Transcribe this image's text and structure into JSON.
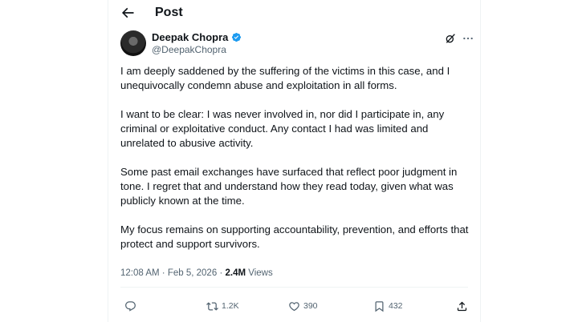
{
  "header": {
    "title": "Post"
  },
  "author": {
    "name": "Deepak Chopra",
    "handle": "@DeepakChopra"
  },
  "post": {
    "paragraphs": [
      "I am deeply saddened by the suffering of the victims in this case, and I unequivocally condemn abuse and exploitation in all forms.",
      "I want to be clear: I was never involved in, nor did I participate in, any criminal or exploitative conduct. Any contact I had was limited and unrelated to abusive activity.",
      "Some past email exchanges have surfaced that reflect poor judgment in tone. I regret that and understand how they read today, given what was publicly known at the time.",
      "My focus remains on supporting accountability, prevention, and efforts that protect and support survivors."
    ],
    "time": "12:08 AM",
    "dot": "·",
    "date": "Feb 5, 2026",
    "views_count": "2.4M",
    "views_label": "Views"
  },
  "actions": {
    "reposts": "1.2K",
    "likes": "390",
    "bookmarks": "432"
  },
  "colors": {
    "verified": "#1d9bf0",
    "muted": "#536471",
    "text": "#0f1419",
    "border": "#eff3f4"
  },
  "icons": [
    "back-arrow-icon",
    "verified-badge-icon",
    "grok-icon",
    "more-icon",
    "reply-icon",
    "repost-icon",
    "like-icon",
    "bookmark-icon",
    "share-icon"
  ]
}
